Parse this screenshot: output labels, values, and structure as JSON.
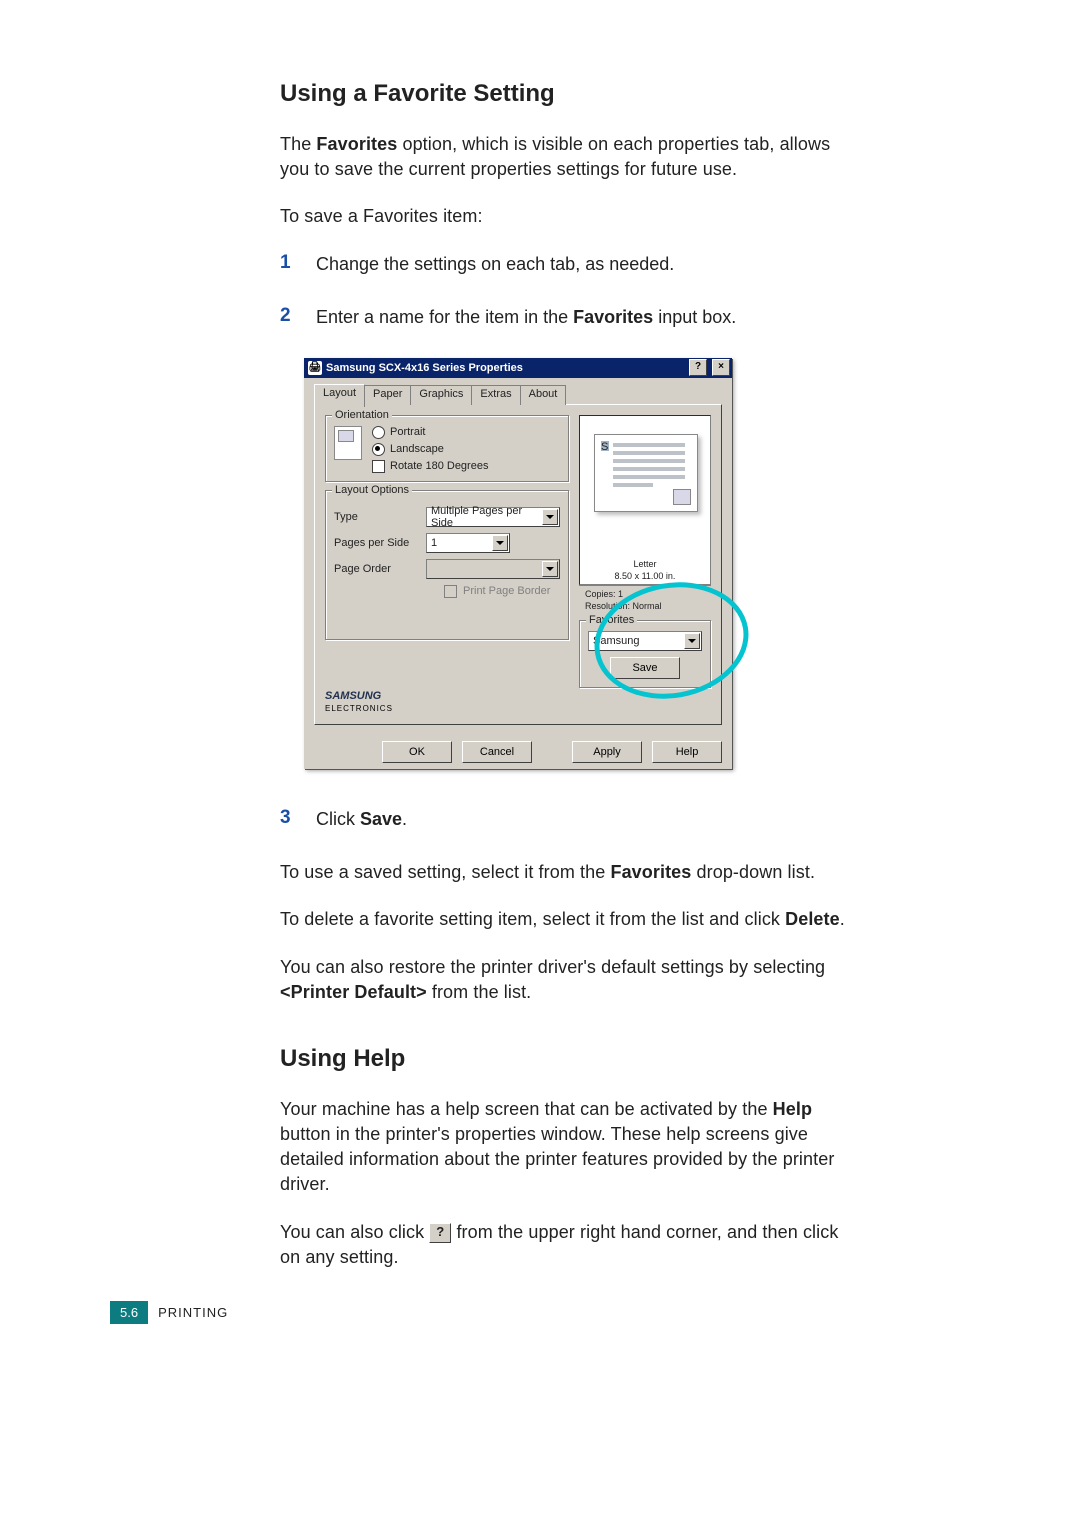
{
  "heading1": "Using a Favorite Setting",
  "p1_a": "The ",
  "p1_b": "Favorites",
  "p1_c": " option, which is visible on each properties tab, allows you to save the current properties settings for future use.",
  "p2": "To save a Favorites item:",
  "steps": {
    "s1_num": "1",
    "s1_txt": "Change the settings on each tab, as needed.",
    "s2_num": "2",
    "s2_a": "Enter a name for the item in the ",
    "s2_b": "Favorites",
    "s2_c": " input box.",
    "s3_num": "3",
    "s3_a": "Click ",
    "s3_b": "Save",
    "s3_c": "."
  },
  "p3_a": "To use a saved setting, select it from the ",
  "p3_b": "Favorites",
  "p3_c": " drop-down list.",
  "p4_a": "To delete a favorite setting item, select it from the list and click ",
  "p4_b": "Delete",
  "p4_c": ".",
  "p5_a": "You can also restore the printer driver's default settings by selecting ",
  "p5_b": "<Printer Default>",
  "p5_c": " from the list.",
  "heading2": "Using Help",
  "p6_a": "Your machine has a help screen that can be activated by the ",
  "p6_b": "Help",
  "p6_c": " button in the printer's properties window. These help screens give detailed information about the printer features provided by the printer driver.",
  "p7_a": "You can also click ",
  "p7_b": " from the upper right hand corner, and then click on any setting.",
  "help_q": "?",
  "footer": {
    "pagenum": "5.6",
    "section": "PRINTING"
  },
  "dialog": {
    "title": "Samsung SCX-4x16 Series Properties",
    "tabs": {
      "t0": "Layout",
      "t1": "Paper",
      "t2": "Graphics",
      "t3": "Extras",
      "t4": "About"
    },
    "orientation": {
      "legend": "Orientation",
      "portrait": "Portrait",
      "landscape": "Landscape",
      "rotate": "Rotate 180 Degrees"
    },
    "layoutopts": {
      "legend": "Layout Options",
      "type_lbl": "Type",
      "type_val": "Multiple Pages per Side",
      "pps_lbl": "Pages per Side",
      "pps_val": "1",
      "order_lbl": "Page Order",
      "order_val": "",
      "ppb": "Print Page Border"
    },
    "preview": {
      "paper": "Letter",
      "dims": "8.50 x 11.00 in.",
      "copies": "Copies: 1",
      "res": "Resolution: Normal"
    },
    "favorites": {
      "legend": "Favorites",
      "value": "Samsung",
      "save": "Save"
    },
    "brand1": "SAMSUNG",
    "brand2": "ELECTRONICS",
    "buttons": {
      "ok": "OK",
      "cancel": "Cancel",
      "apply": "Apply",
      "help": "Help"
    },
    "tb_q": "?",
    "tb_x": "×"
  }
}
